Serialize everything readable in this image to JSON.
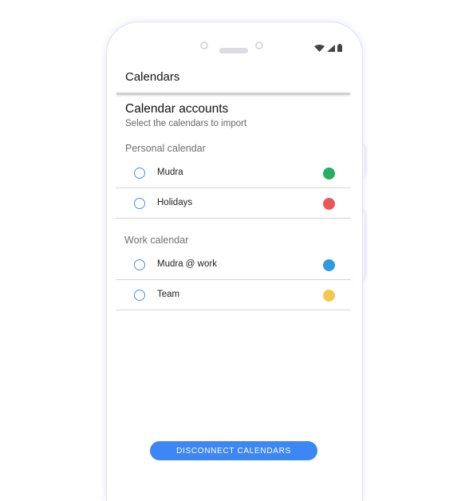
{
  "header": {
    "title": "Calendars"
  },
  "accounts": {
    "title": "Calendar accounts",
    "subtitle": "Select the calendars to import",
    "groups": [
      {
        "label": "Personal calendar",
        "items": [
          {
            "label": "Mudra",
            "color": "#27ae60"
          },
          {
            "label": "Holidays",
            "color": "#eb5757"
          }
        ]
      },
      {
        "label": "Work calendar",
        "items": [
          {
            "label": "Mudra @ work",
            "color": "#2d9cdb"
          },
          {
            "label": "Team",
            "color": "#f2c94c"
          }
        ]
      }
    ]
  },
  "footer": {
    "disconnect_label": "DISCONNECT CALENDARS"
  },
  "colors": {
    "accent": "#3d87f5",
    "radio": "#4a90e2"
  },
  "status_icons": [
    "wifi-icon",
    "cellular-signal-icon",
    "battery-icon"
  ]
}
